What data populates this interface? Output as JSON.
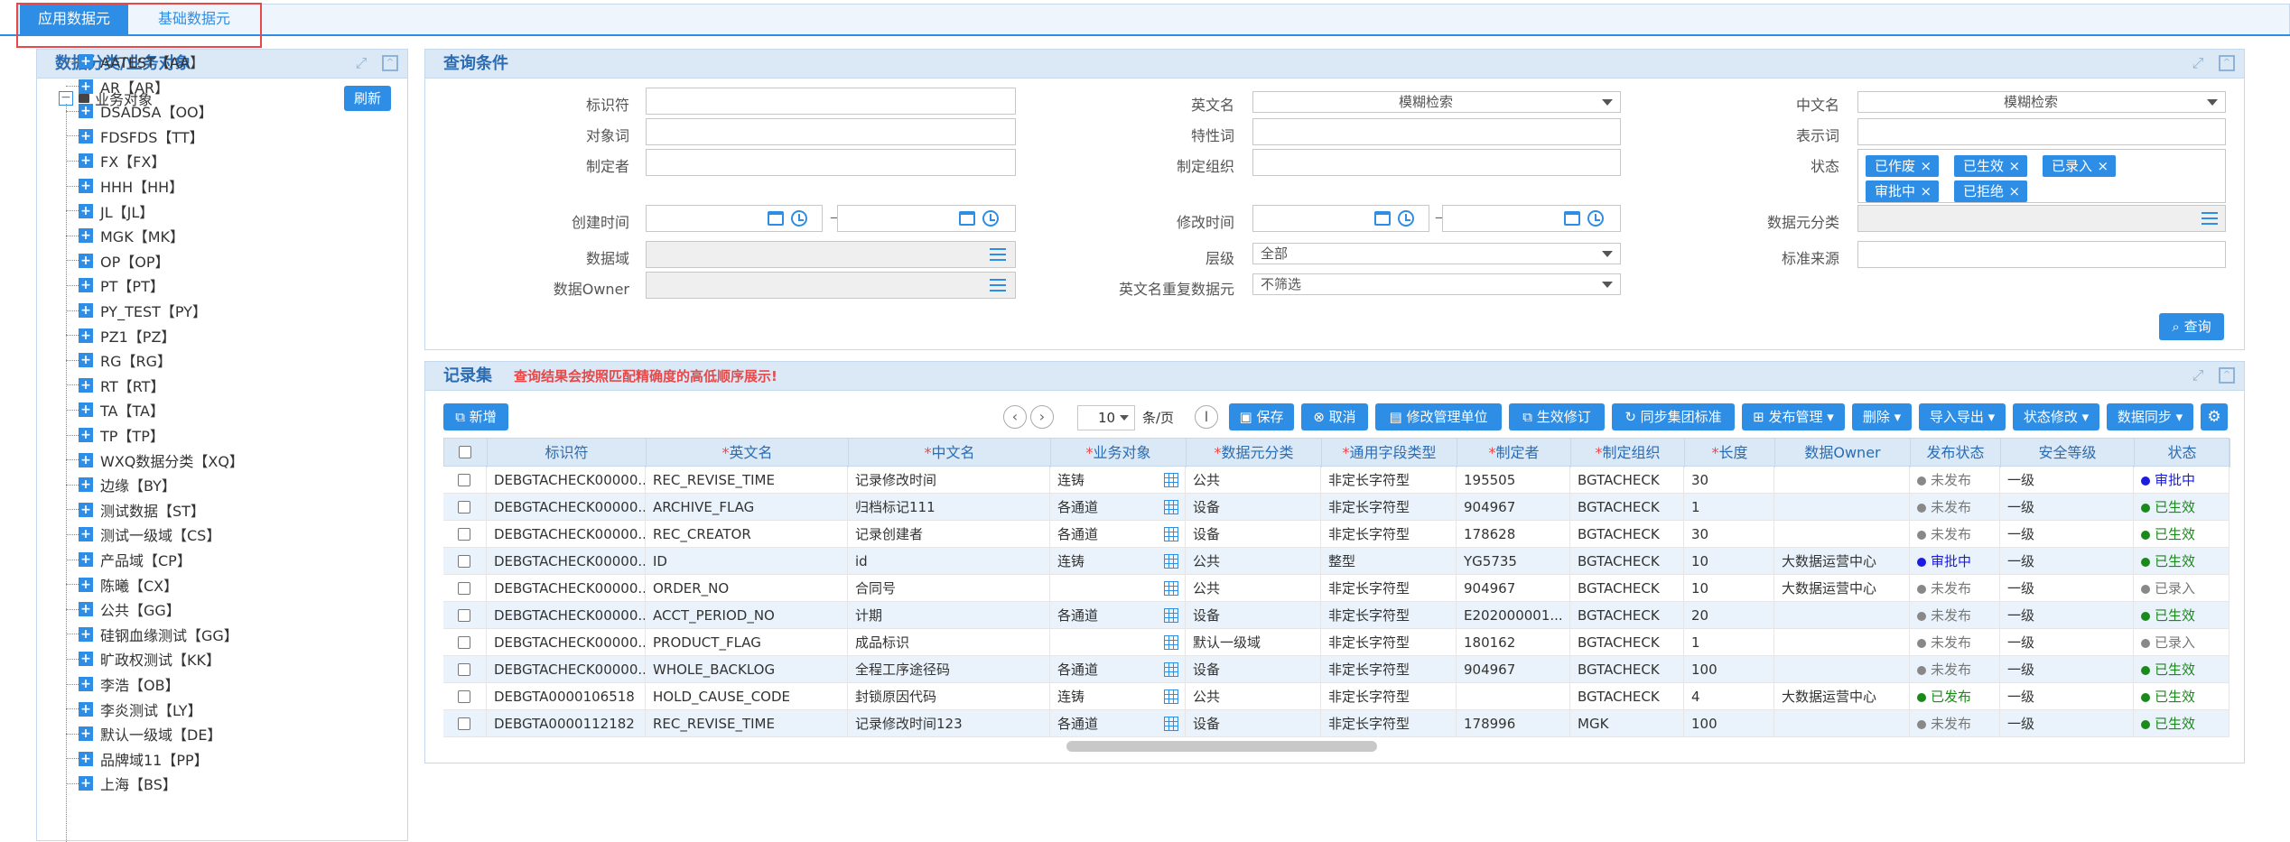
{
  "tabs": [
    {
      "label": "应用数据元",
      "active": true
    },
    {
      "label": "基础数据元",
      "active": false
    }
  ],
  "left": {
    "title": "数据分类/业务对象",
    "refresh": "刷新",
    "root": "业务对象",
    "items": [
      "AATEST【AA】",
      "AR【AR】",
      "DSADSA【OO】",
      "FDSFDS【TT】",
      "FX【FX】",
      "HHH【HH】",
      "JL【JL】",
      "MGK【MK】",
      "OP【OP】",
      "PT【PT】",
      "PY_TEST【PY】",
      "PZ1【PZ】",
      "RG【RG】",
      "RT【RT】",
      "TA【TA】",
      "TP【TP】",
      "WXQ数据分类【XQ】",
      "边缘【BY】",
      "测试数据【ST】",
      "测试一级域【CS】",
      "产品域【CP】",
      "陈曦【CX】",
      "公共【GG】",
      "硅钢血缘测试【GG】",
      "旷政权测试【KK】",
      "李浩【OB】",
      "李炎测试【LY】",
      "默认一级域【DE】",
      "品牌域11【PP】",
      "上海【BS】"
    ]
  },
  "query": {
    "title": "查询条件",
    "labels": {
      "identifier": "标识符",
      "en_name": "英文名",
      "cn_name": "中文名",
      "object_word": "对象词",
      "feature_word": "特性词",
      "repr_word": "表示词",
      "creator": "制定者",
      "org": "制定组织",
      "status": "状态",
      "created": "创建时间",
      "modified": "修改时间",
      "category": "数据元分类",
      "domain": "数据域",
      "level": "层级",
      "std_source": "标准来源",
      "owner": "数据Owner",
      "dup": "英文名重复数据元"
    },
    "fuzzy": "模糊检索",
    "level_value": "全部",
    "dup_value": "不筛选",
    "status_tags": [
      "已作废",
      "已生效",
      "已录入",
      "审批中",
      "已拒绝"
    ],
    "range_sep": "—",
    "search": "查询"
  },
  "records": {
    "title": "记录集",
    "note": "查询结果会按照匹配精确度的高低顺序展示!",
    "add": "新增",
    "page_size": "10",
    "per_page": "条/页",
    "buttons": [
      "保存",
      "取消",
      "修改管理单位",
      "生效修订",
      "同步集团标准",
      "发布管理",
      "删除",
      "导入导出",
      "状态修改",
      "数据同步"
    ],
    "columns": [
      "标识符",
      "英文名",
      "中文名",
      "业务对象",
      "数据元分类",
      "通用字段类型",
      "制定者",
      "制定组织",
      "长度",
      "数据Owner",
      "发布状态",
      "安全等级",
      "状态"
    ],
    "required": [
      false,
      true,
      true,
      true,
      true,
      true,
      true,
      true,
      true,
      false,
      false,
      false,
      false
    ],
    "rows": [
      [
        "DEBGTACHECK00000...",
        "REC_REVISE_TIME",
        "记录修改时间",
        "连铸",
        "公共",
        "非定长字符型",
        "195505",
        "BGTACHECK",
        "30",
        "",
        "未发布",
        "一级",
        "审批中"
      ],
      [
        "DEBGTACHECK00000...",
        "ARCHIVE_FLAG",
        "归档标记111",
        "各通道",
        "设备",
        "非定长字符型",
        "904967",
        "BGTACHECK",
        "1",
        "",
        "未发布",
        "一级",
        "已生效"
      ],
      [
        "DEBGTACHECK00000...",
        "REC_CREATOR",
        "记录创建者",
        "各通道",
        "设备",
        "非定长字符型",
        "178628",
        "BGTACHECK",
        "30",
        "",
        "未发布",
        "一级",
        "已生效"
      ],
      [
        "DEBGTACHECK00000...",
        "ID",
        "id",
        "连铸",
        "公共",
        "整型",
        "YG5735",
        "BGTACHECK",
        "10",
        "大数据运营中心",
        "审批中",
        "一级",
        "已生效"
      ],
      [
        "DEBGTACHECK00000...",
        "ORDER_NO",
        "合同号",
        "",
        "公共",
        "非定长字符型",
        "904967",
        "BGTACHECK",
        "10",
        "大数据运营中心",
        "未发布",
        "一级",
        "已录入"
      ],
      [
        "DEBGTACHECK00000...",
        "ACCT_PERIOD_NO",
        "计期",
        "各通道",
        "设备",
        "非定长字符型",
        "E202000001...",
        "BGTACHECK",
        "20",
        "",
        "未发布",
        "一级",
        "已生效"
      ],
      [
        "DEBGTACHECK00000...",
        "PRODUCT_FLAG",
        "成品标识",
        "",
        "默认一级域",
        "非定长字符型",
        "180162",
        "BGTACHECK",
        "1",
        "",
        "未发布",
        "一级",
        "已录入"
      ],
      [
        "DEBGTACHECK00000...",
        "WHOLE_BACKLOG",
        "全程工序途径码",
        "各通道",
        "设备",
        "非定长字符型",
        "904967",
        "BGTACHECK",
        "100",
        "",
        "未发布",
        "一级",
        "已生效"
      ],
      [
        "DEBGTA0000106518",
        "HOLD_CAUSE_CODE",
        "封锁原因代码",
        "连铸",
        "公共",
        "非定长字符型",
        "",
        "BGTACHECK",
        "4",
        "大数据运营中心",
        "已发布",
        "一级",
        "已生效"
      ],
      [
        "DEBGTA0000112182",
        "REC_REVISE_TIME",
        "记录修改时间123",
        "各通道",
        "设备",
        "非定长字符型",
        "178996",
        "MGK",
        "100",
        "",
        "未发布",
        "一级",
        "已生效"
      ]
    ]
  },
  "colors": {
    "primary": "#2e8de5",
    "header_bg": "#dbe9f7",
    "title_text": "#2b6cb2",
    "approving": "#1c1ce0",
    "effective": "#1a8a1a",
    "unpublished": "#888888",
    "entered": "#888888",
    "alert": "#e84848"
  },
  "icons": [
    "collapse-icon",
    "expand-icon",
    "folder-icon",
    "maximize-icon",
    "minimize-icon",
    "calendar-icon",
    "clock-icon",
    "list-icon",
    "search-icon",
    "save-icon",
    "cancel-icon",
    "refresh-icon",
    "gear-icon",
    "prev-page-icon",
    "next-page-icon",
    "text-icon",
    "table-picker-icon"
  ]
}
